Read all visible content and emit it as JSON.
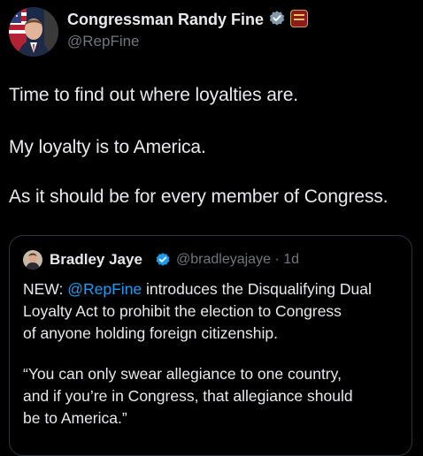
{
  "author": {
    "display_name": "Congressman Randy Fine",
    "handle": "@RepFine",
    "avatar_icon": "profile-photo-flag",
    "verified_icon": "verified-badge-icon",
    "affiliation_icon": "government-affiliation-badge-icon"
  },
  "tweet": {
    "lines": [
      "Time to find out where loyalties are.",
      "My loyalty is to America.",
      "As it should be for every member of Congress."
    ]
  },
  "quote": {
    "display_name": "Bradley Jaye",
    "meta": "@bradleyajaye · 1d",
    "avatar_icon": "profile-photo",
    "verified_icon": "verified-badge-icon",
    "line1_prefix": "NEW: ",
    "line1_mention": "@RepFine",
    "line1_suffix": " introduces the Disqualifying Dual",
    "lines": [
      "Loyalty Act  to prohibit the election to Congress",
      "of anyone holding foreign citizenship.",
      "“You can only swear allegiance to one country,",
      "and if you’re in Congress, that allegiance should",
      "be to America.”"
    ]
  },
  "colors": {
    "background": "#000000",
    "text": "#e7e9ea",
    "secondary": "#71767b",
    "link": "#1d9bf0",
    "border": "#2f3336"
  }
}
